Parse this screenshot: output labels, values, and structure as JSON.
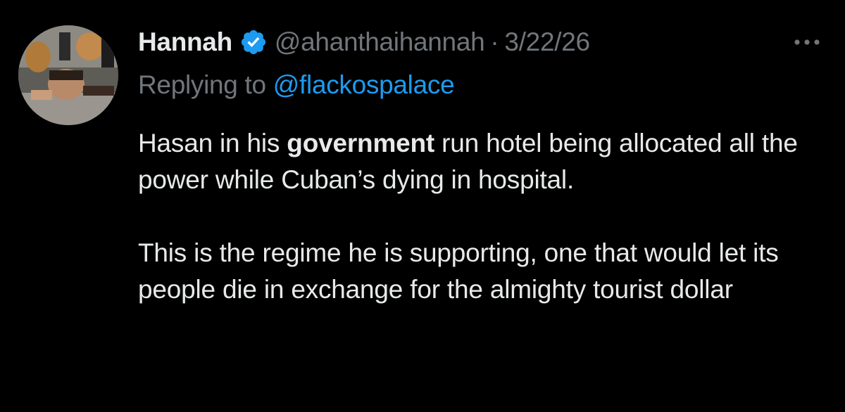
{
  "tweet": {
    "author": {
      "display_name": "Hannah",
      "handle": "@ahanthaihannah",
      "verified_icon": "verified-badge-icon",
      "avatar": "avatar-photo"
    },
    "separator": "·",
    "date": "3/22/26",
    "more_icon": "more-options-icon",
    "reply": {
      "prefix": "Replying to",
      "target": "@flackospalace"
    },
    "body": {
      "p1_start": "Hasan in his ",
      "p1_bold": "government",
      "p1_end": " run hotel being allocated all the power while Cuban’s dying in hospital.",
      "p2": "This is the regime he is supporting, one that would let its people die in exchange for the almighty tourist dollar"
    }
  },
  "colors": {
    "background": "#000000",
    "text_primary": "#e7e9ea",
    "text_secondary": "#71767b",
    "link": "#1d9bf0",
    "verified": "#1d9bf0"
  }
}
